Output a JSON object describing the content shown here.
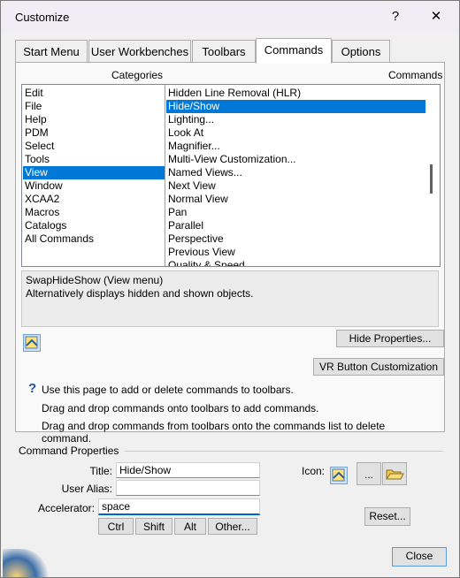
{
  "window": {
    "title": "Customize",
    "help_glyph": "?",
    "close_glyph": "✕"
  },
  "tabs": [
    {
      "label": "Start Menu"
    },
    {
      "label": "User Workbenches"
    },
    {
      "label": "Toolbars"
    },
    {
      "label": "Commands",
      "active": true
    },
    {
      "label": "Options"
    }
  ],
  "categories_header": "Categories",
  "commands_header": "Commands",
  "categories": [
    "Edit",
    "File",
    "Help",
    "PDM",
    "Select",
    "Tools",
    "View",
    "Window",
    "XCAA2",
    "Macros",
    "Catalogs",
    "All Commands"
  ],
  "selected_category": "View",
  "commands": [
    "Hidden Line Removal (HLR)",
    "Hide/Show",
    "Lighting...",
    "Look At",
    "Magnifier...",
    "Multi-View Customization...",
    "Named Views...",
    "Next View",
    "Normal View",
    "Pan",
    "Parallel",
    "Perspective",
    "Previous View",
    "Quality & Speed"
  ],
  "selected_command": "Hide/Show",
  "description": {
    "line1": "SwapHideShow (View menu)",
    "line2": "Alternatively displays hidden and shown objects."
  },
  "buttons": {
    "hide_properties": "Hide Properties...",
    "vr_button": "VR Button Customization",
    "close": "Close",
    "reset": "Reset...",
    "icon_browse": "...",
    "ctrl": "Ctrl",
    "shift": "Shift",
    "alt": "Alt",
    "other": "Other..."
  },
  "help": {
    "glyph": "?",
    "line1": "Use this page to add or delete commands to toolbars.",
    "line2": "Drag and drop commands onto toolbars to add commands.",
    "line3": "Drag and drop commands from toolbars onto the commands list to delete command."
  },
  "command_properties": {
    "group_label": "Command Properties",
    "title_label": "Title:",
    "title_value": "Hide/Show",
    "alias_label": "User Alias:",
    "alias_value": "",
    "accelerator_label": "Accelerator:",
    "accelerator_value": "space",
    "icon_label": "Icon:"
  },
  "colors": {
    "selection": "#0078d7",
    "window_bg": "#f0f0f0",
    "focus_accent": "#0067c0"
  },
  "icons": [
    "help-icon",
    "close-icon",
    "command-icon",
    "folder-open-icon",
    "help-question-icon"
  ]
}
